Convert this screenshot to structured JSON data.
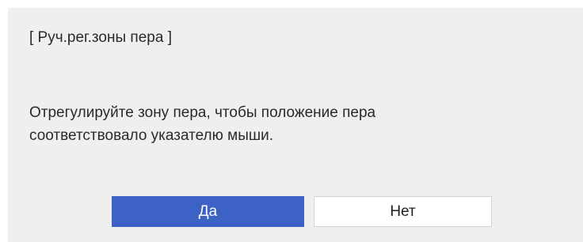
{
  "dialog": {
    "title": "[ Руч.рег.зоны пера ]",
    "message_lines": [
      "Отрегулируйте зону пера, чтобы положение пера",
      "соответствовало указателю мыши."
    ],
    "buttons": {
      "yes_label": "Да",
      "no_label": "Нет"
    }
  },
  "colors": {
    "dialog_background": "#efefef",
    "primary_button": "#3d62c6",
    "secondary_button": "#ffffff",
    "text": "#2a2a2a"
  }
}
